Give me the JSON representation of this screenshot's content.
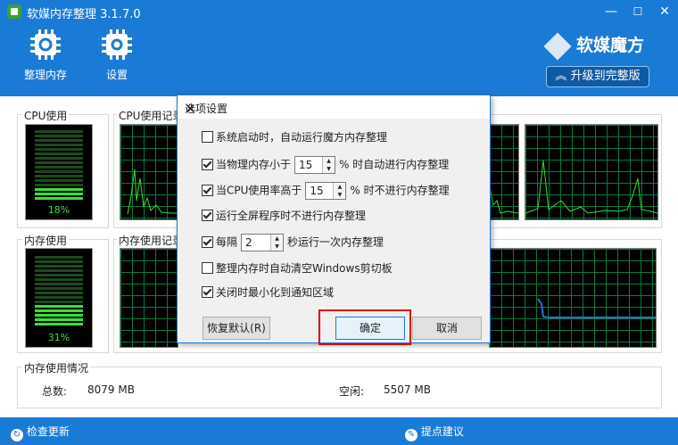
{
  "window": {
    "title": "软媒内存整理 3.1.7.0",
    "minimize": "—",
    "maximize": "☐",
    "close": "✕"
  },
  "toolbar": {
    "clean_label": "整理内存",
    "settings_label": "设置"
  },
  "brand": {
    "name": "软媒魔方",
    "upgrade_label": "升级到完整版"
  },
  "cpu": {
    "label": "CPU使用",
    "percent": "18%",
    "level": 0.18,
    "history_label": "CPU使用记录"
  },
  "memory": {
    "label": "内存使用",
    "percent": "31%",
    "level": 0.31,
    "history_label": "内存使用记录"
  },
  "memory_info": {
    "label": "内存使用情况",
    "total_label": "总数:",
    "total_value": "8079 MB",
    "free_label": "空闲:",
    "free_value": "5507 MB"
  },
  "footer": {
    "update_label": "检查更新",
    "feedback_label": "提点建议"
  },
  "dialog": {
    "title": "选项设置",
    "close": "✕",
    "options": [
      {
        "checked": false,
        "text": "系统启动时，自动运行魔方内存整理"
      },
      {
        "checked": true,
        "text_before": "当物理内存小于",
        "value": "15",
        "text_after": "% 时自动进行内存整理"
      },
      {
        "checked": true,
        "text_before": "当CPU使用率高于",
        "value": "15",
        "text_after": "% 时不进行内存整理"
      },
      {
        "checked": true,
        "text": "运行全屏程序时不进行内存整理"
      },
      {
        "checked": true,
        "text_before": "每隔",
        "value": "2",
        "text_after": "秒运行一次内存整理"
      },
      {
        "checked": false,
        "text": "整理内存时自动清空Windows剪切板"
      },
      {
        "checked": true,
        "text": "关闭时最小化到通知区域"
      }
    ],
    "reset_label": "恢复默认(R)",
    "ok_label": "确定",
    "cancel_label": "取消"
  },
  "colors": {
    "accent": "#1a7bd6",
    "gauge_on": "#36e236",
    "gauge_off": "#1c4a1c",
    "grid": "#0b7a3a",
    "highlight": "#e3000f"
  }
}
